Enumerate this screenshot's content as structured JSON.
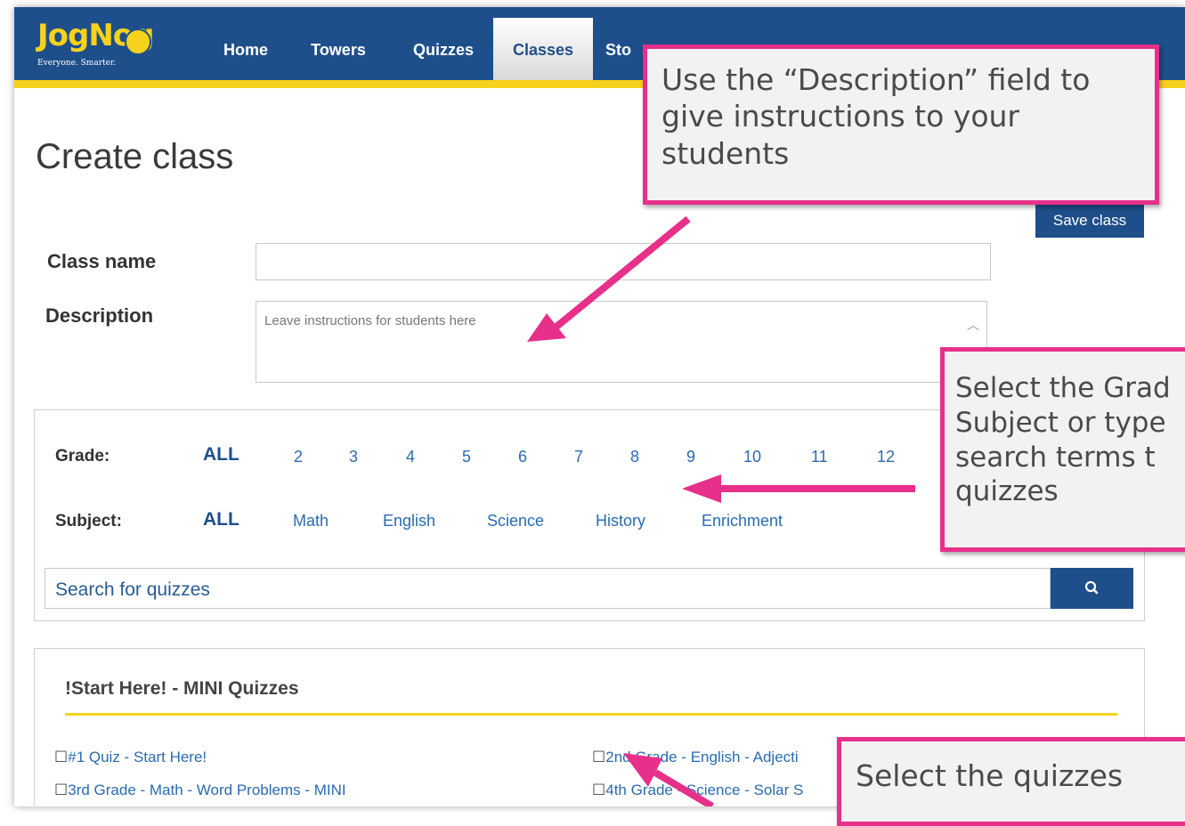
{
  "brand": {
    "logo_text": "JogNog",
    "tagline": "Everyone. Smarter."
  },
  "nav": {
    "items": [
      "Home",
      "Towers",
      "Quizzes",
      "Classes",
      "Sto"
    ],
    "active": "Classes"
  },
  "page": {
    "title": "Create class",
    "save_label": "Save class"
  },
  "form": {
    "class_name_label": "Class name",
    "class_name_value": "",
    "description_label": "Description",
    "description_placeholder": "Leave instructions for students here"
  },
  "filters": {
    "grade_label": "Grade:",
    "grade_all": "ALL",
    "grades": [
      "2",
      "3",
      "4",
      "5",
      "6",
      "7",
      "8",
      "9",
      "10",
      "11",
      "12"
    ],
    "subject_label": "Subject:",
    "subject_all": "ALL",
    "subjects": [
      "Math",
      "English",
      "Science",
      "History",
      "Enrichment"
    ],
    "search_placeholder": "Search for quizzes"
  },
  "quiz_section": {
    "title": "!Start Here! - MINI Quizzes",
    "checkbox_glyph": "☐",
    "items": [
      "#1 Quiz - Start Here!",
      "2nd Grade - English - Adjecti",
      "3rd Grade - Math - Word Problems - MINI",
      "4th Grade - Science - Solar S"
    ]
  },
  "callouts": [
    "Use the “Description” field to\ngive instructions to your\nstudents",
    "Select the Grad\nSubject or type\nsearch terms t\nquizzes",
    "Select the quizzes"
  ],
  "colors": {
    "nav_bg": "#1e4f8a",
    "nav_accent": "#f7d21c",
    "link": "#2a6bb0",
    "callout_border": "#e6308a"
  }
}
